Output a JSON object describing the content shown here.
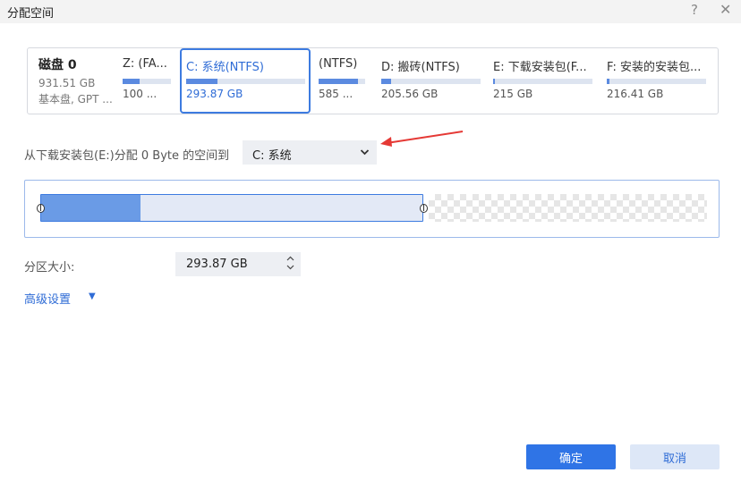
{
  "window": {
    "title": "分配空间",
    "help": "?",
    "close": "✕"
  },
  "disk": {
    "name": "磁盘 0",
    "size": "931.51 GB",
    "type": "基本盘, GPT ..."
  },
  "partitions": [
    {
      "name": "Z: (FA...",
      "size": "100 ...",
      "used_fraction": 0.35
    },
    {
      "name": "C: 系统(NTFS)",
      "size": "293.87 GB",
      "used_fraction": 0.26,
      "selected": true
    },
    {
      "name": "(NTFS)",
      "size": "585 ...",
      "used_fraction": 0.85
    },
    {
      "name": "D: 搬砖(NTFS)",
      "size": "205.56 GB",
      "used_fraction": 0.1
    },
    {
      "name": "E: 下载安装包(F...",
      "size": "215 GB",
      "used_fraction": 0.02
    },
    {
      "name": "F: 安装的安装包...",
      "size": "216.41 GB",
      "used_fraction": 0.03
    }
  ],
  "allocate": {
    "label": "从下载安装包(E:)分配 0 Byte 的空间到",
    "target_value": "C: 系统"
  },
  "resize": {
    "used_fraction": 0.26
  },
  "size": {
    "label": "分区大小:",
    "value": "293.87 GB"
  },
  "advanced": {
    "label": "高级设置",
    "caret": "▼"
  },
  "buttons": {
    "ok": "确定",
    "cancel": "取消"
  },
  "colors": {
    "accent": "#2f74e6",
    "used": "#6a9be6",
    "annotation_arrow": "#e53935"
  }
}
